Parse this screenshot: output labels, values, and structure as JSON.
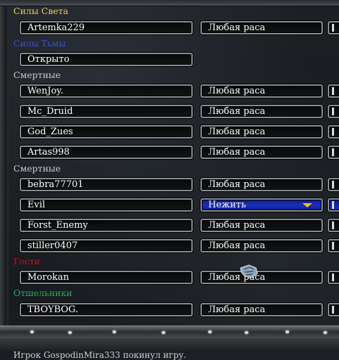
{
  "colors": {
    "light": "#e8c86a",
    "dark": "#3a4fd8",
    "mortals": "#c8c8c8",
    "guests": "#c0141b",
    "hermits": "#1fb153",
    "selected_race": "#1c2fb8"
  },
  "groups": {
    "light": "Силы Света",
    "dark": "Силы Тьмы",
    "mortals1": "Смертные",
    "mortals2": "Смертные",
    "guests": "Гости",
    "hermits": "Отшельники"
  },
  "slots": [
    {
      "name": "Artemka229",
      "race": "Любая раса"
    },
    {
      "name": "Открыто"
    },
    {
      "name": "WenJoy.",
      "race": "Любая раса"
    },
    {
      "name": "Mc_Druid",
      "race": "Любая раса"
    },
    {
      "name": "God_Zues",
      "race": "Любая раса"
    },
    {
      "name": "Artas998",
      "race": "Любая раса"
    },
    {
      "name": "bebra77701",
      "race": "Любая раса"
    },
    {
      "name": "Evil",
      "race": "Нежить"
    },
    {
      "name": "Forst_Enemy",
      "race": "Любая раса"
    },
    {
      "name": "stiller0407",
      "race": "Любая раса"
    },
    {
      "name": "Morokan",
      "race": "Любая раса"
    },
    {
      "name": "TBOYBOG.",
      "race": "Любая раса"
    }
  ],
  "icons": {
    "race_dropdown": "chevron-down-icon",
    "cursor": "gauntlet-cursor-icon"
  },
  "chat": {
    "message": "Игрок GospodinMira333 покинул игру."
  }
}
